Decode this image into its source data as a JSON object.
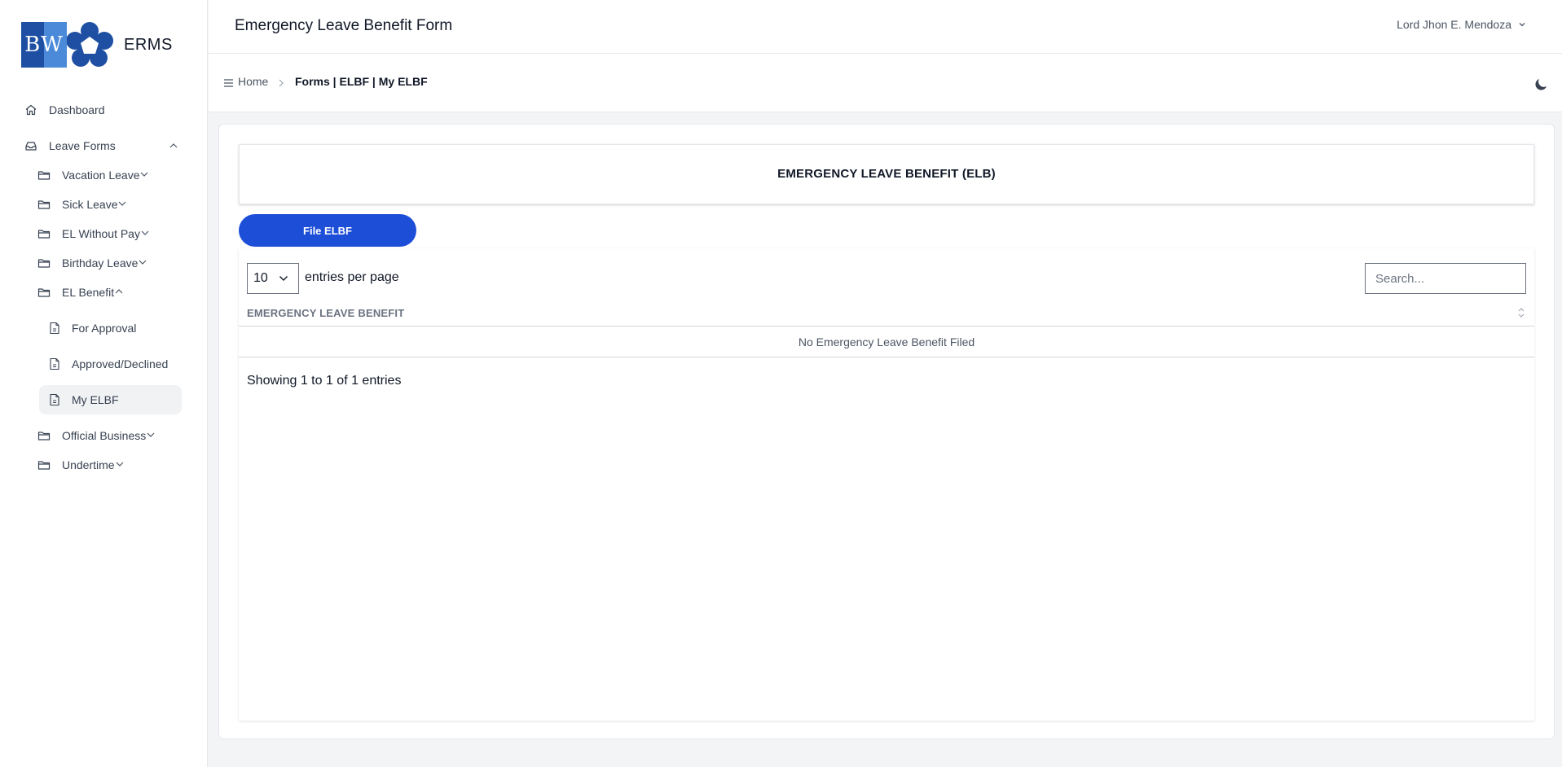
{
  "brand": {
    "logo_text": "BW",
    "name": "ERMS"
  },
  "sidebar": {
    "dashboard": "Dashboard",
    "leave_forms": "Leave Forms",
    "groups": [
      {
        "label": "Vacation Leave",
        "expanded": false
      },
      {
        "label": "Sick Leave",
        "expanded": false
      },
      {
        "label": "EL Without Pay",
        "expanded": false
      },
      {
        "label": "Birthday Leave",
        "expanded": false
      },
      {
        "label": "EL Benefit",
        "expanded": true
      }
    ],
    "el_benefit_items": [
      {
        "label": "For Approval",
        "active": false
      },
      {
        "label": "Approved/Declined",
        "active": false
      },
      {
        "label": "My ELBF",
        "active": true
      }
    ],
    "groups_after": [
      {
        "label": "Official Business",
        "expanded": false
      },
      {
        "label": "Undertime",
        "expanded": false
      }
    ]
  },
  "header": {
    "title": "Emergency Leave Benefit Form",
    "user_name": "Lord Jhon E. Mendoza"
  },
  "breadcrumb": {
    "home": "Home",
    "current": "Forms | ELBF | My ELBF"
  },
  "main": {
    "section_title": "EMERGENCY LEAVE BENEFIT (ELB)",
    "file_button": "File ELBF",
    "per_page_value": "10",
    "per_page_label": "entries per page",
    "search_placeholder": "Search...",
    "column_header": "EMERGENCY LEAVE BENEFIT",
    "empty_message": "No Emergency Leave Benefit Filed",
    "info": "Showing 1 to 1 of 1 entries"
  },
  "colors": {
    "accent": "#1d4ed8",
    "logo_dark": "#1e4fa3",
    "logo_light": "#4a8ad8"
  },
  "icons": {
    "dashboard": "home-icon",
    "leave_forms": "inbox-icon",
    "group": "folder-icon",
    "sub_item": "document-icon",
    "theme": "moon-icon",
    "menu": "hamburger-icon"
  }
}
